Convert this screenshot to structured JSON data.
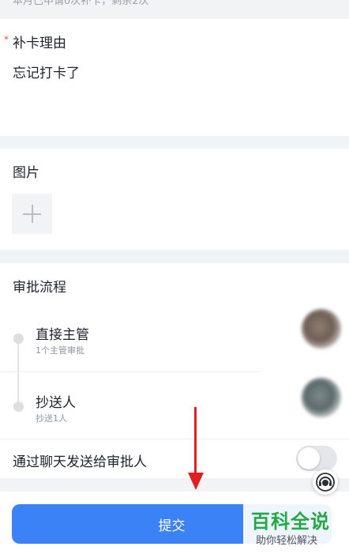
{
  "top": {
    "faded_text": "本月已申请0次补卡，剩余2次"
  },
  "reason": {
    "required_mark": "*",
    "label": "补卡理由",
    "value": "忘记打卡了"
  },
  "images": {
    "label": "图片"
  },
  "approval": {
    "label": "审批流程",
    "steps": [
      {
        "title": "直接主管",
        "subtitle": "1个主管审批"
      },
      {
        "title": "抄送人",
        "subtitle": "抄送1人"
      }
    ],
    "send_via_chat_label": "通过聊天发送给审批人",
    "send_via_chat_enabled": false
  },
  "footer": {
    "submit_label": "提交"
  },
  "watermark": {
    "main": "百科全说",
    "sub": "助你轻松解决"
  },
  "colors": {
    "primary": "#3b82f6",
    "annotation_arrow": "#e02020",
    "watermark_green": "#22a845"
  }
}
